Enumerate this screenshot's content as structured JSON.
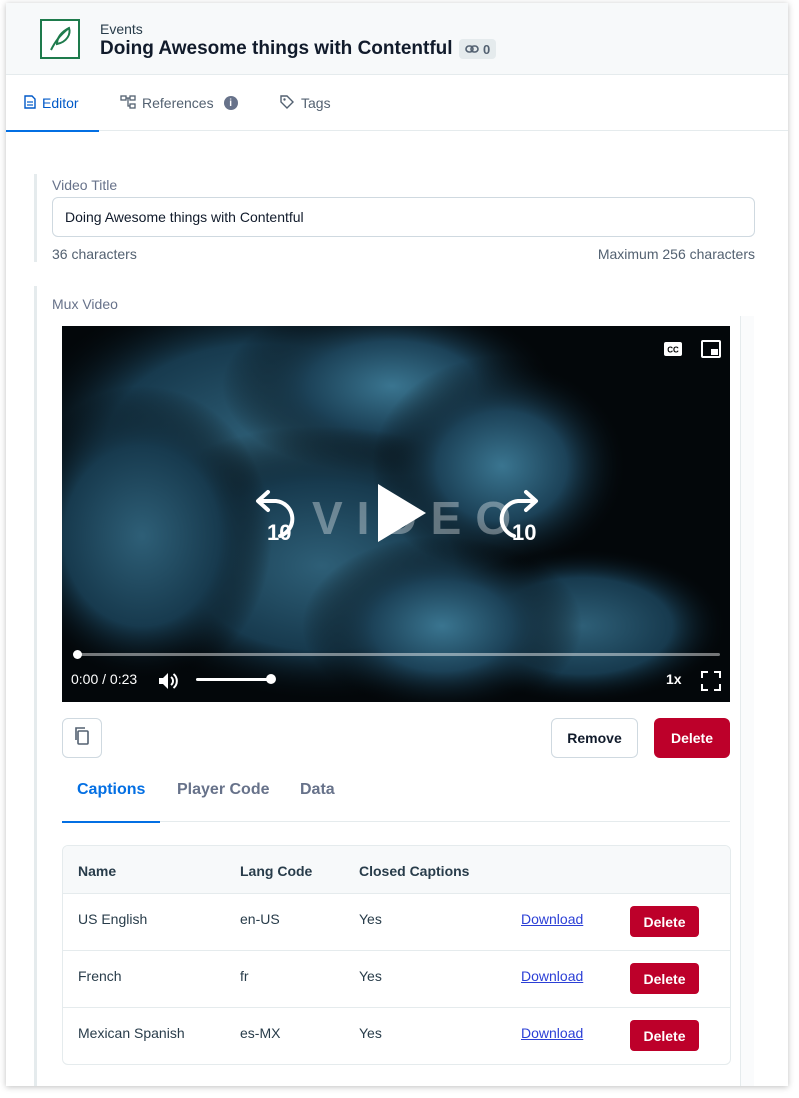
{
  "header": {
    "content_type": "Events",
    "title": "Doing Awesome things with Contentful",
    "references_count": "0"
  },
  "entry_tabs": [
    {
      "label": "Editor",
      "icon": "document-icon"
    },
    {
      "label": "References",
      "icon": "references-icon"
    },
    {
      "label": "Tags",
      "icon": "tag-icon"
    }
  ],
  "video_title_field": {
    "label": "Video Title",
    "value": "Doing Awesome things with Contentful",
    "char_count": "36 characters",
    "char_limit": "Maximum 256 characters"
  },
  "mux_field": {
    "label": "Mux Video",
    "player": {
      "watermark": "VIDEO",
      "seek_back_label": "10",
      "seek_forward_label": "10",
      "time": "0:00 / 0:23",
      "speed": "1x",
      "progress": 0,
      "volume": 1
    },
    "remove_label": "Remove",
    "delete_label": "Delete",
    "tabs": [
      "Captions",
      "Player Code",
      "Data"
    ],
    "captions_table": {
      "headers": [
        "Name",
        "Lang Code",
        "Closed Captions"
      ],
      "rows": [
        {
          "name": "US English",
          "lang": "en-US",
          "closed": "Yes",
          "download": "Download",
          "delete": "Delete"
        },
        {
          "name": "French",
          "lang": "fr",
          "closed": "Yes",
          "download": "Download",
          "delete": "Delete"
        },
        {
          "name": "Mexican Spanish",
          "lang": "es-MX",
          "closed": "Yes",
          "download": "Download",
          "delete": "Delete"
        }
      ]
    }
  },
  "colors": {
    "accent": "#036fe3",
    "danger": "#bd002a",
    "logo_green": "#1e7b4c"
  }
}
